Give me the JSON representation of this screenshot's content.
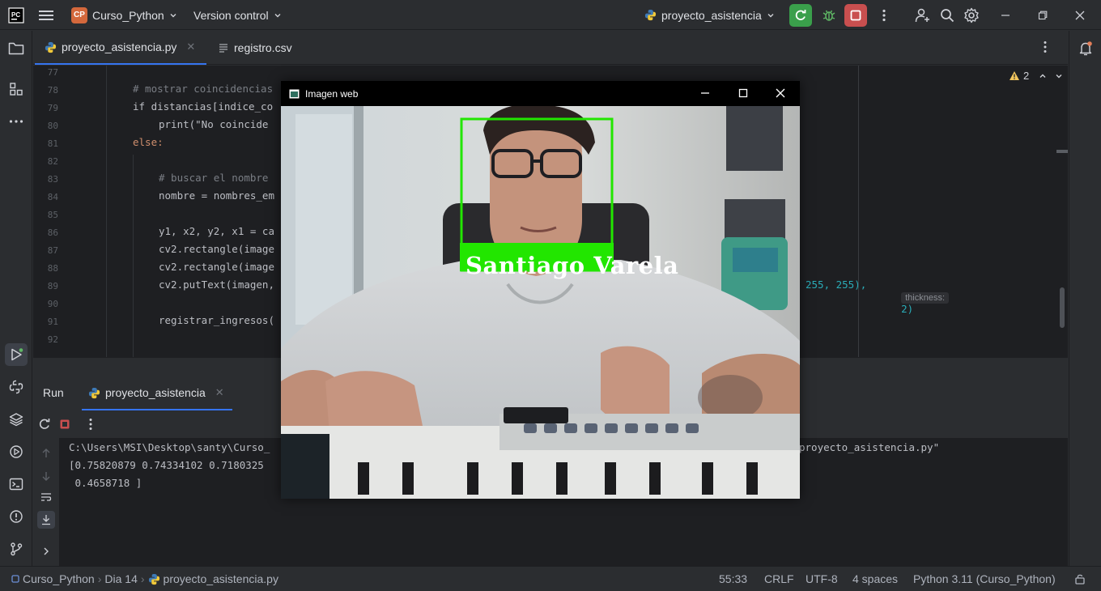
{
  "titlebar": {
    "project_badge": "CP",
    "project_name": "Curso_Python",
    "vcs_label": "Version control",
    "run_config": "proyecto_asistencia"
  },
  "tabs": [
    {
      "label": "proyecto_asistencia.py",
      "active": true
    },
    {
      "label": "registro.csv",
      "active": false
    }
  ],
  "editor": {
    "warnings_count": "2",
    "lines": [
      {
        "n": "77",
        "text": ""
      },
      {
        "n": "78",
        "text": "# mostrar coincidencias"
      },
      {
        "n": "79",
        "text": "if distancias[indice_co"
      },
      {
        "n": "80",
        "text": "print(\"No coincide"
      },
      {
        "n": "81",
        "text": "else:"
      },
      {
        "n": "82",
        "text": ""
      },
      {
        "n": "83",
        "text": "# buscar el nombre"
      },
      {
        "n": "84",
        "text": "nombre = nombres_em"
      },
      {
        "n": "85",
        "text": ""
      },
      {
        "n": "86",
        "text": "y1, x2, y2, x1 = ca"
      },
      {
        "n": "87",
        "text": "cv2.rectangle(image"
      },
      {
        "n": "88",
        "text": "cv2.rectangle(image"
      },
      {
        "n": "89",
        "text": "cv2.putText(imagen,"
      },
      {
        "n": "90",
        "text": ""
      },
      {
        "n": "91",
        "text": "registrar_ingresos("
      },
      {
        "n": "92",
        "text": ""
      }
    ],
    "line89_tail": "255, 255),",
    "hint_label": "thickness:",
    "hint_value": "2)"
  },
  "opencv_window": {
    "title": "Imagen web",
    "face_label": "Santiago Varela"
  },
  "run_panel": {
    "title": "Run",
    "tab_label": "proyecto_asistencia",
    "console_lines": [
      "C:\\Users\\MSI\\Desktop\\santy\\Curso_",
      "[0.75820879 0.74334102 0.7180325",
      " 0.4658718 ]"
    ],
    "console_line1_tail": "proyecto_asistencia.py\""
  },
  "statusbar": {
    "breadcrumb": [
      "Curso_Python",
      "Dia 14",
      "proyecto_asistencia.py"
    ],
    "position": "55:33",
    "line_ending": "CRLF",
    "encoding": "UTF-8",
    "indent": "4 spaces",
    "interpreter": "Python 3.11 (Curso_Python)"
  },
  "colors": {
    "accent": "#3574f0",
    "run_green": "#3a9f4b",
    "stop_red": "#c94f4f",
    "face_box": "#22e600"
  }
}
